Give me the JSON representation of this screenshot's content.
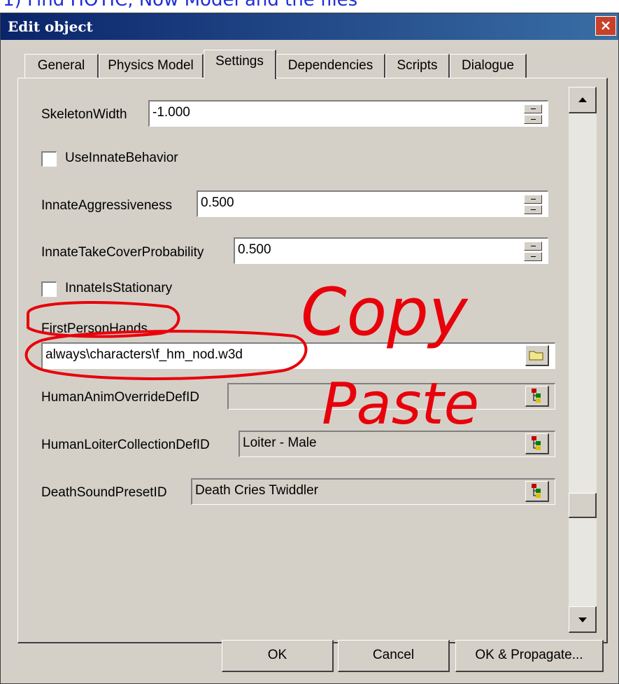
{
  "overlay_text": "1) Find HOTIC, Now Model and the files",
  "window": {
    "title": "Edit object",
    "close_glyph": "×"
  },
  "tabs": [
    "General",
    "Physics Model",
    "Settings",
    "Dependencies",
    "Scripts",
    "Dialogue"
  ],
  "active_tab": "Settings",
  "settings": {
    "skeleton_width_label": "SkeletonWidth",
    "skeleton_width_value": "-1.000",
    "use_innate_behavior_label": "UseInnateBehavior",
    "use_innate_behavior_checked": false,
    "innate_aggressiveness_label": "InnateAggressiveness",
    "innate_aggressiveness_value": "0.500",
    "innate_take_cover_label": "InnateTakeCoverProbability",
    "innate_take_cover_value": "0.500",
    "innate_is_stationary_label": "InnateIsStationary",
    "innate_is_stationary_checked": false,
    "first_person_hands_label": "FirstPersonHands",
    "first_person_hands_value": "always\\characters\\f_hm_nod.w3d",
    "human_anim_override_label": "HumanAnimOverrideDefID",
    "human_anim_override_value": "",
    "human_loiter_label": "HumanLoiterCollectionDefID",
    "human_loiter_value": "Loiter - Male",
    "death_sound_label": "DeathSoundPresetID",
    "death_sound_value": "Death Cries Twiddler"
  },
  "annotations": {
    "copy": "Copy",
    "paste": "Paste",
    "color": "#e8000b"
  },
  "buttons": {
    "ok": "OK",
    "cancel": "Cancel",
    "ok_propagate": "OK & Propagate..."
  },
  "icons": [
    "close-icon",
    "folder-icon",
    "tree-picker-icon",
    "scroll-up-icon",
    "scroll-down-icon"
  ]
}
